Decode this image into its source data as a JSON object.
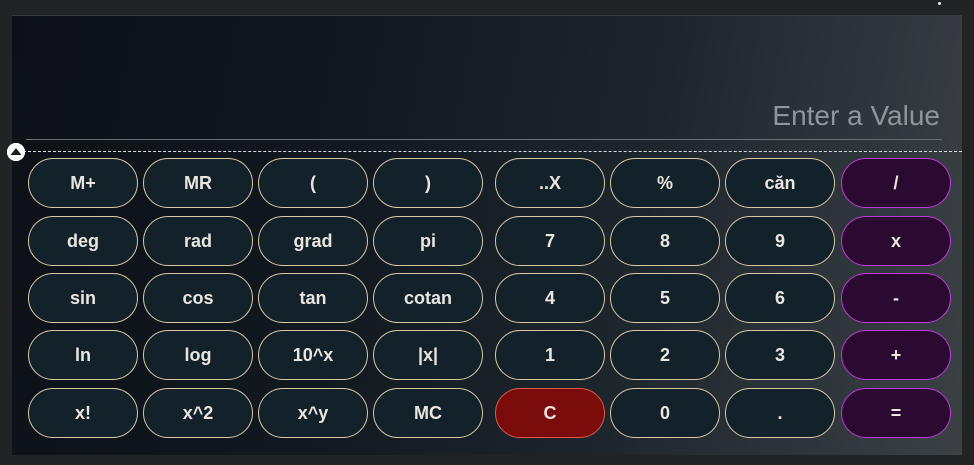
{
  "display": {
    "placeholder": "Enter a Value"
  },
  "keys": {
    "m_plus": "M+",
    "m_recall": "MR",
    "paren_open": "(",
    "paren_close": ")",
    "dot_x": "..X",
    "percent": "%",
    "sqrt": "căn",
    "divide": "/",
    "deg": "deg",
    "rad": "rad",
    "grad": "grad",
    "pi": "pi",
    "seven": "7",
    "eight": "8",
    "nine": "9",
    "multiply": "x",
    "sin": "sin",
    "cos": "cos",
    "tan": "tan",
    "cotan": "cotan",
    "four": "4",
    "five": "5",
    "six": "6",
    "minus": "-",
    "ln": "ln",
    "log": "log",
    "pow10": "10^x",
    "abs": "|x|",
    "one": "1",
    "two": "2",
    "three": "3",
    "plus": "+",
    "factorial": "x!",
    "square": "x^2",
    "power": "x^y",
    "m_clear": "MC",
    "clear": "C",
    "zero": "0",
    "decimal": ".",
    "equals": "="
  },
  "colors": {
    "key_bg": "#13212a",
    "key_border": "#d9c7a8",
    "operator_bg": "#2a0a30",
    "operator_border": "#c03ad8",
    "clear_bg": "#7a0c0c",
    "clear_border": "#d85a4a"
  },
  "icons": {
    "handle": "chevron-up-icon"
  }
}
